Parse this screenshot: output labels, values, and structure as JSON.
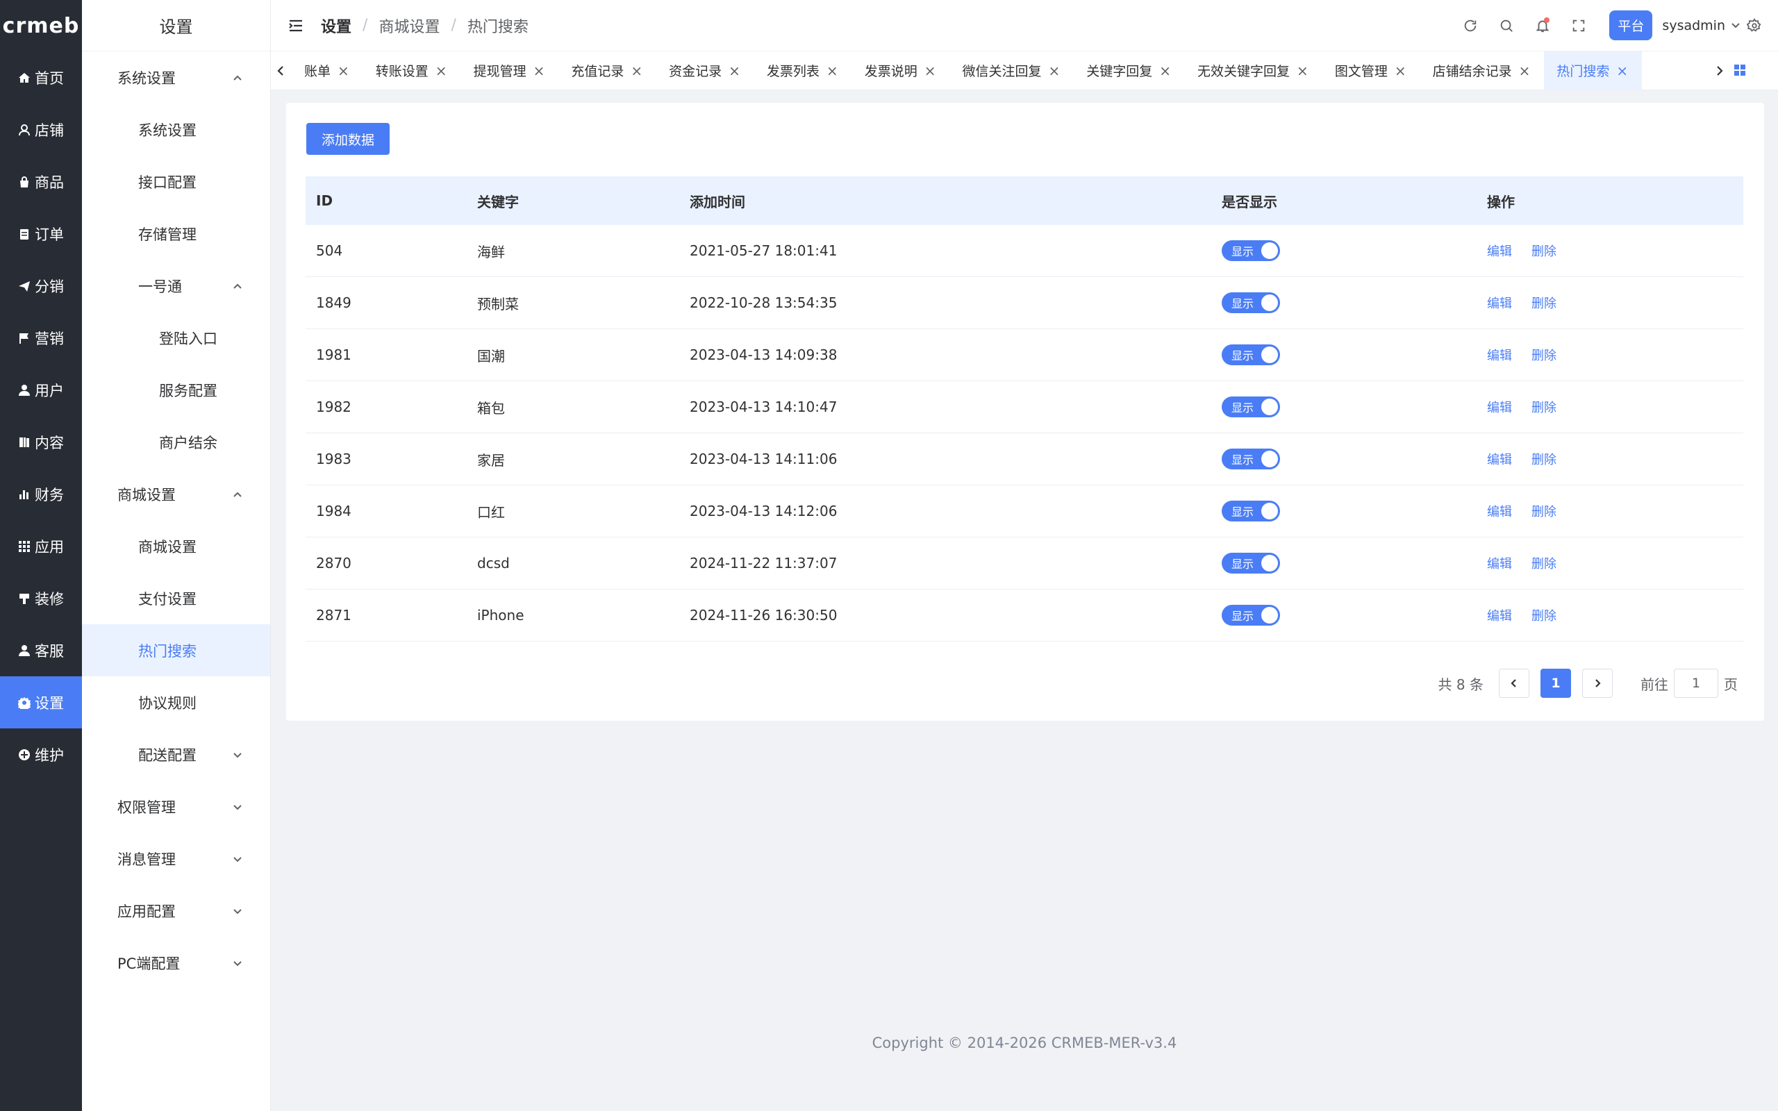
{
  "logo": "crmeb",
  "rail": [
    {
      "label": "首页",
      "icon": "home-icon"
    },
    {
      "label": "店铺",
      "icon": "store-icon"
    },
    {
      "label": "商品",
      "icon": "bag-icon"
    },
    {
      "label": "订单",
      "icon": "order-icon"
    },
    {
      "label": "分销",
      "icon": "send-icon"
    },
    {
      "label": "营销",
      "icon": "flag-icon"
    },
    {
      "label": "用户",
      "icon": "user-icon"
    },
    {
      "label": "内容",
      "icon": "book-icon"
    },
    {
      "label": "财务",
      "icon": "chart-icon"
    },
    {
      "label": "应用",
      "icon": "apps-icon"
    },
    {
      "label": "装修",
      "icon": "brush-icon"
    },
    {
      "label": "客服",
      "icon": "service-icon"
    },
    {
      "label": "设置",
      "icon": "gear-icon",
      "active": true
    },
    {
      "label": "维护",
      "icon": "plus-circle-icon"
    }
  ],
  "sidebar": {
    "title": "设置",
    "items": [
      {
        "label": "系统设置",
        "level": 1,
        "chevron": "up"
      },
      {
        "label": "系统设置",
        "level": 2
      },
      {
        "label": "接口配置",
        "level": 2
      },
      {
        "label": "存储管理",
        "level": 2
      },
      {
        "label": "一号通",
        "level": 2,
        "chevron": "up"
      },
      {
        "label": "登陆入口",
        "level": 3
      },
      {
        "label": "服务配置",
        "level": 3
      },
      {
        "label": "商户结余",
        "level": 3
      },
      {
        "label": "商城设置",
        "level": 1,
        "chevron": "up"
      },
      {
        "label": "商城设置",
        "level": 2
      },
      {
        "label": "支付设置",
        "level": 2
      },
      {
        "label": "热门搜索",
        "level": 2,
        "active": true
      },
      {
        "label": "协议规则",
        "level": 2
      },
      {
        "label": "配送配置",
        "level": 2,
        "chevron": "down"
      },
      {
        "label": "权限管理",
        "level": 1,
        "chevron": "down"
      },
      {
        "label": "消息管理",
        "level": 1,
        "chevron": "down"
      },
      {
        "label": "应用配置",
        "level": 1,
        "chevron": "down"
      },
      {
        "label": "PC端配置",
        "level": 1,
        "chevron": "down"
      }
    ]
  },
  "header": {
    "breadcrumb": [
      "设置",
      "商城设置",
      "热门搜索"
    ],
    "platform_label": "平台",
    "user_name": "sysadmin"
  },
  "tabs": [
    {
      "label": "账单"
    },
    {
      "label": "转账设置"
    },
    {
      "label": "提现管理"
    },
    {
      "label": "充值记录"
    },
    {
      "label": "资金记录"
    },
    {
      "label": "发票列表"
    },
    {
      "label": "发票说明"
    },
    {
      "label": "微信关注回复"
    },
    {
      "label": "关键字回复"
    },
    {
      "label": "无效关键字回复"
    },
    {
      "label": "图文管理"
    },
    {
      "label": "店铺结余记录"
    },
    {
      "label": "热门搜索",
      "active": true
    }
  ],
  "main": {
    "add_button": "添加数据",
    "columns": [
      "ID",
      "关键字",
      "添加时间",
      "是否显示",
      "操作"
    ],
    "rows": [
      {
        "id": "504",
        "keyword": "海鲜",
        "time": "2021-05-27 18:01:41",
        "show": "显示",
        "edit": "编辑",
        "delete": "删除"
      },
      {
        "id": "1849",
        "keyword": "预制菜",
        "time": "2022-10-28 13:54:35",
        "show": "显示",
        "edit": "编辑",
        "delete": "删除"
      },
      {
        "id": "1981",
        "keyword": "国潮",
        "time": "2023-04-13 14:09:38",
        "show": "显示",
        "edit": "编辑",
        "delete": "删除"
      },
      {
        "id": "1982",
        "keyword": "箱包",
        "time": "2023-04-13 14:10:47",
        "show": "显示",
        "edit": "编辑",
        "delete": "删除"
      },
      {
        "id": "1983",
        "keyword": "家居",
        "time": "2023-04-13 14:11:06",
        "show": "显示",
        "edit": "编辑",
        "delete": "删除"
      },
      {
        "id": "1984",
        "keyword": "口红",
        "time": "2023-04-13 14:12:06",
        "show": "显示",
        "edit": "编辑",
        "delete": "删除"
      },
      {
        "id": "2870",
        "keyword": "dcsd",
        "time": "2024-11-22 11:37:07",
        "show": "显示",
        "edit": "编辑",
        "delete": "删除"
      },
      {
        "id": "2871",
        "keyword": "iPhone",
        "time": "2024-11-26 16:30:50",
        "show": "显示",
        "edit": "编辑",
        "delete": "删除"
      }
    ],
    "pagination": {
      "total_text": "共 8 条",
      "current_page": "1",
      "goto_label": "前往",
      "goto_value": "1",
      "page_suffix": "页"
    }
  },
  "footer": "Copyright © 2014-2026 CRMEB-MER-v3.4",
  "colors": {
    "accent": "#4a7df5",
    "rail_bg": "#282c34",
    "active_bg": "#eaf2ff"
  }
}
